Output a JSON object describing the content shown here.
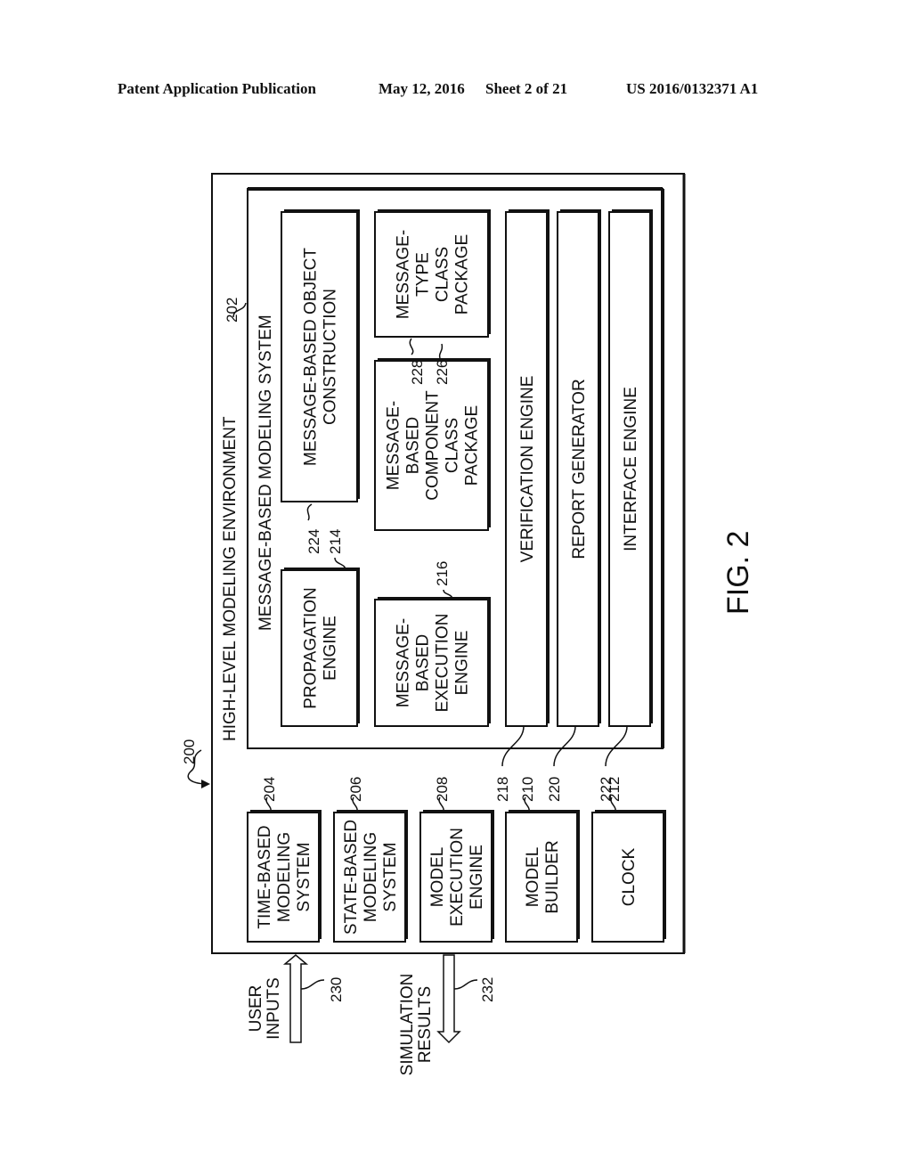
{
  "header": {
    "left": "Patent Application Publication",
    "date": "May 12, 2016",
    "sheet": "Sheet 2 of 21",
    "number": "US 2016/0132371 A1"
  },
  "figure": {
    "label": "FIG. 2",
    "ref": "200",
    "environment": {
      "title": "HIGH-LEVEL MODELING ENVIRONMENT"
    },
    "subsystem": {
      "title": "MESSAGE-BASED MODELING SYSTEM",
      "ref": "202"
    },
    "left_boxes": [
      {
        "lines": [
          "TIME-BASED",
          "MODELING",
          "SYSTEM"
        ],
        "ref": "204"
      },
      {
        "lines": [
          "STATE-BASED",
          "MODELING",
          "SYSTEM"
        ],
        "ref": "206"
      },
      {
        "lines": [
          "MODEL",
          "EXECUTION",
          "ENGINE"
        ],
        "ref": "208"
      },
      {
        "lines": [
          "MODEL",
          "BUILDER"
        ],
        "ref": "210"
      },
      {
        "lines": [
          "CLOCK"
        ],
        "ref": "212"
      }
    ],
    "inner_boxes": [
      {
        "lines": [
          "PROPAGATION",
          "ENGINE"
        ],
        "ref": "214"
      },
      {
        "lines": [
          "MESSAGE-",
          "BASED",
          "EXECUTION",
          "ENGINE"
        ],
        "ref": "216"
      },
      {
        "lines": [
          "MESSAGE-BASED OBJECT",
          "CONSTRUCTION"
        ],
        "ref": "224"
      },
      {
        "lines": [
          "MESSAGE-",
          "BASED",
          "COMPONENT",
          "CLASS",
          "PACKAGE"
        ],
        "ref": "226"
      },
      {
        "lines": [
          "MESSAGE-",
          "TYPE",
          "CLASS",
          "PACKAGE"
        ],
        "ref": "228"
      }
    ],
    "bars": [
      {
        "label": "VERIFICATION ENGINE",
        "ref": "218"
      },
      {
        "label": "REPORT GENERATOR",
        "ref": "220"
      },
      {
        "label": "INTERFACE ENGINE",
        "ref": "222"
      }
    ],
    "io": [
      {
        "lines": [
          "USER",
          "INPUTS"
        ],
        "ref": "230",
        "direction": "in"
      },
      {
        "lines": [
          "SIMULATION",
          "RESULTS"
        ],
        "ref": "232",
        "direction": "out"
      }
    ]
  }
}
